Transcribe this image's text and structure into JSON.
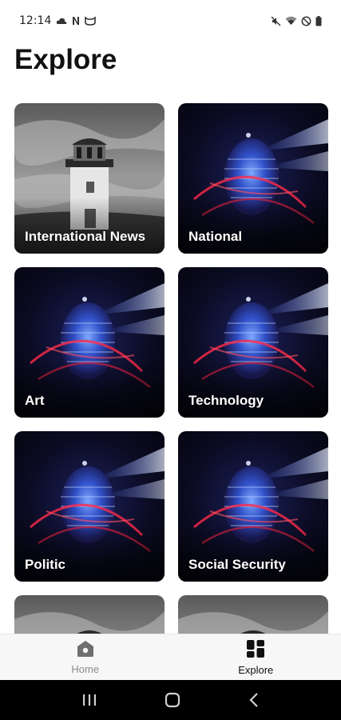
{
  "status_bar": {
    "time": "12:14",
    "left_icons": [
      "cloud-icon",
      "n-icon",
      "cat-face-icon"
    ],
    "right_icons": [
      "mute-icon",
      "wifi-icon",
      "do-not-disturb-icon",
      "battery-icon"
    ]
  },
  "page": {
    "title": "Explore"
  },
  "categories": [
    {
      "label": "International News",
      "image": "lighthouse"
    },
    {
      "label": "National",
      "image": "globe"
    },
    {
      "label": "Art",
      "image": "globe"
    },
    {
      "label": "Technology",
      "image": "globe"
    },
    {
      "label": "Politic",
      "image": "globe"
    },
    {
      "label": "Social Security",
      "image": "globe"
    },
    {
      "label": "",
      "image": "lighthouse"
    },
    {
      "label": "",
      "image": "lighthouse"
    }
  ],
  "bottom_nav": {
    "items": [
      {
        "label": "Home",
        "icon": "home-icon",
        "active": false
      },
      {
        "label": "Explore",
        "icon": "grid-icon",
        "active": true
      }
    ]
  },
  "system_nav": {
    "buttons": [
      "recents-icon",
      "home-button-icon",
      "back-icon"
    ]
  },
  "colors": {
    "background": "#ffffff",
    "nav_background": "#f7f7f7",
    "active": "#111111",
    "inactive": "#8a8a8a",
    "system_nav": "#000000"
  }
}
